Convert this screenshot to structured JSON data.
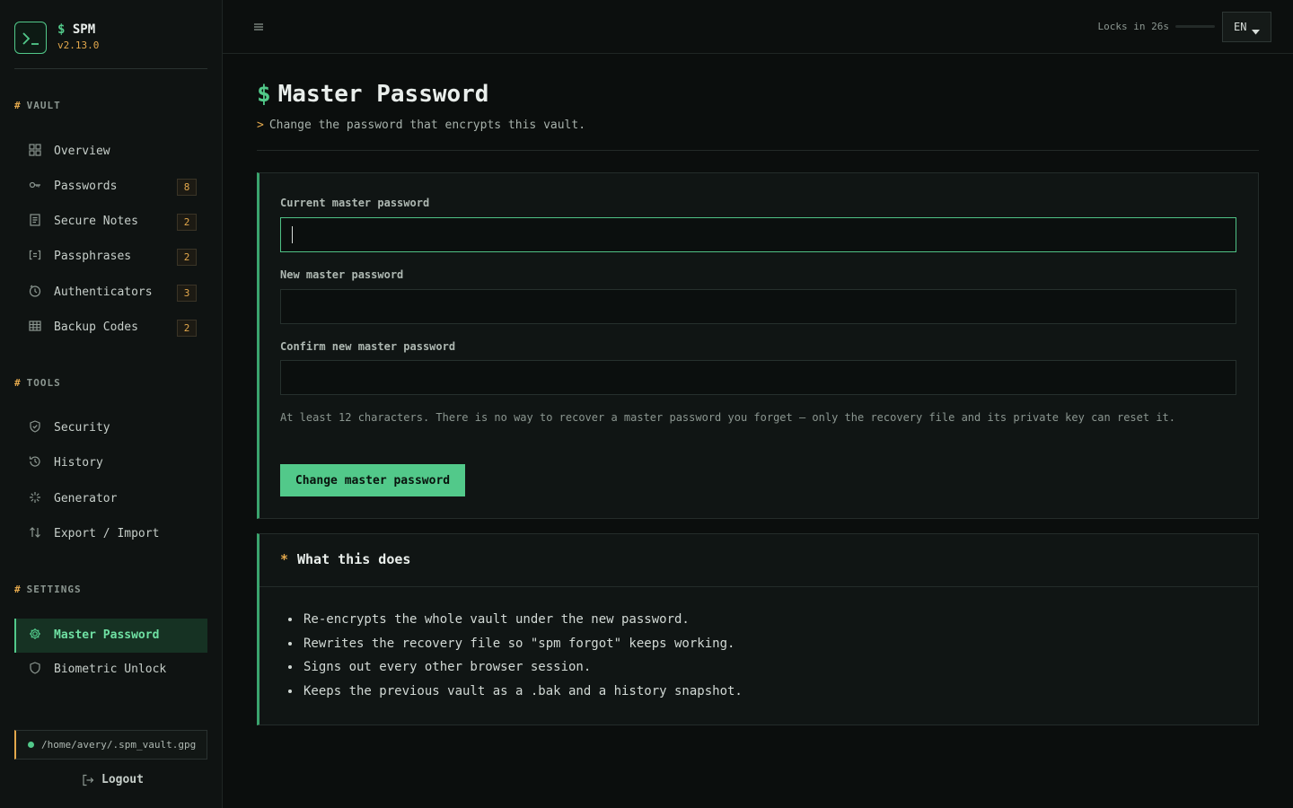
{
  "app": {
    "name": "SPM",
    "prompt": "$",
    "version": "v2.13.0"
  },
  "sidebar": {
    "sections": [
      {
        "hash": "#",
        "title": "VAULT"
      },
      {
        "hash": "#",
        "title": "TOOLS"
      },
      {
        "hash": "#",
        "title": "SETTINGS"
      }
    ],
    "vault_items": [
      {
        "label": "Overview",
        "icon": "grid-icon"
      },
      {
        "label": "Passwords",
        "icon": "key-icon",
        "badge": "8"
      },
      {
        "label": "Secure Notes",
        "icon": "note-icon",
        "badge": "2"
      },
      {
        "label": "Passphrases",
        "icon": "brackets-icon",
        "badge": "2"
      },
      {
        "label": "Authenticators",
        "icon": "timer-icon",
        "badge": "3"
      },
      {
        "label": "Backup Codes",
        "icon": "table-icon",
        "badge": "2"
      }
    ],
    "tools_items": [
      {
        "label": "Security",
        "icon": "shield-icon"
      },
      {
        "label": "History",
        "icon": "history-icon"
      },
      {
        "label": "Generator",
        "icon": "sparkle-icon"
      },
      {
        "label": "Export / Import",
        "icon": "swap-arrows-icon"
      }
    ],
    "settings_items": [
      {
        "label": "Master Password",
        "icon": "gear-icon",
        "active": true
      },
      {
        "label": "Biometric Unlock",
        "icon": "shield-icon"
      }
    ],
    "vault_path": "/home/avery/.spm_vault.gpg",
    "logout_label": "Logout"
  },
  "topbar": {
    "lock_text": "Locks in 26s",
    "lock_remaining_fraction": 0.0,
    "language": "EN"
  },
  "main": {
    "title_prompt": "$",
    "title": "Master Password",
    "subtitle_prompt": ">",
    "subtitle": "Change the password that encrypts this vault.",
    "form": {
      "current_label": "Current master password",
      "current_value": "",
      "new_label": "New master password",
      "new_value": "",
      "confirm_label": "Confirm new master password",
      "confirm_value": "",
      "hint": "At least 12 characters. There is no way to recover a master password you forget — only the recovery file and its private key can reset it.",
      "submit_label": "Change master password"
    },
    "info": {
      "marker": "*",
      "title": "What this does",
      "items": [
        "Re-encrypts the whole vault under the new password.",
        "Rewrites the recovery file so \"spm forgot\" keeps working.",
        "Signs out every other browser session.",
        "Keeps the previous vault as a .bak and a history snapshot."
      ]
    }
  },
  "colors": {
    "accent": "#52c98a",
    "warning": "#e3a84c",
    "background": "#0b0e0d"
  }
}
